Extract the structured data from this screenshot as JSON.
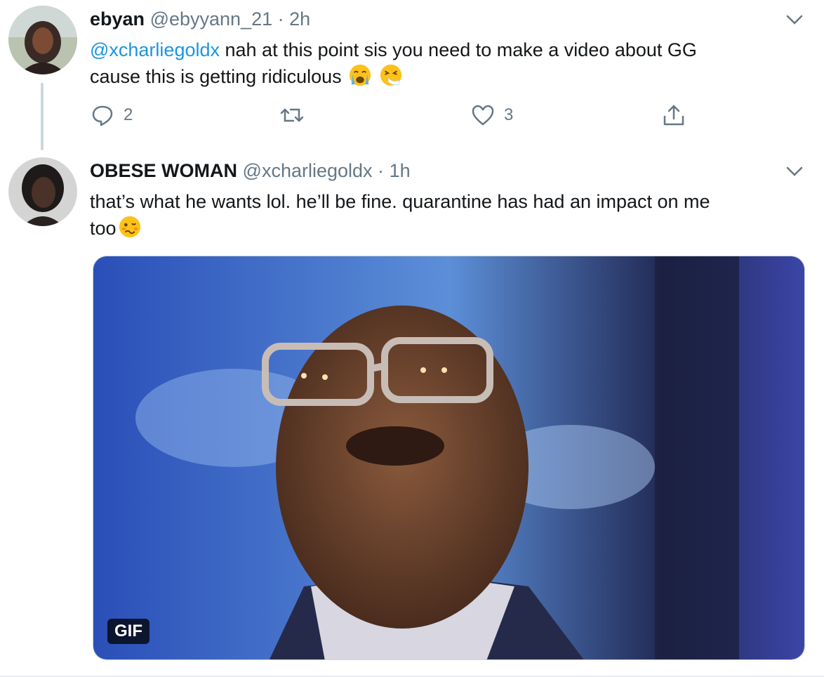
{
  "tweets": [
    {
      "display_name": "ebyan",
      "handle": "@ebyyann_21",
      "separator": "·",
      "time": "2h",
      "mention": "@xcharliegoldx",
      "text_line1": " nah at this point sis you need to make a video about GG",
      "text_line2": "cause this is getting ridiculous",
      "emojis": [
        "loudly-crying-face",
        "sneezing-face"
      ],
      "actions": {
        "replies": "2",
        "retweets": "",
        "likes": "3"
      }
    },
    {
      "display_name": "OBESE WOMAN",
      "handle": "@xcharliegoldx",
      "separator": "·",
      "time": "1h",
      "text_line1": "that’s what he wants lol. he’ll be fine. quarantine has had an impact on me",
      "text_line2": "too",
      "emojis": [
        "woozy-face"
      ],
      "media": {
        "badge": "GIF"
      }
    }
  ],
  "colors": {
    "accent": "#1b95e0",
    "muted": "#657786",
    "text": "#14171a"
  }
}
